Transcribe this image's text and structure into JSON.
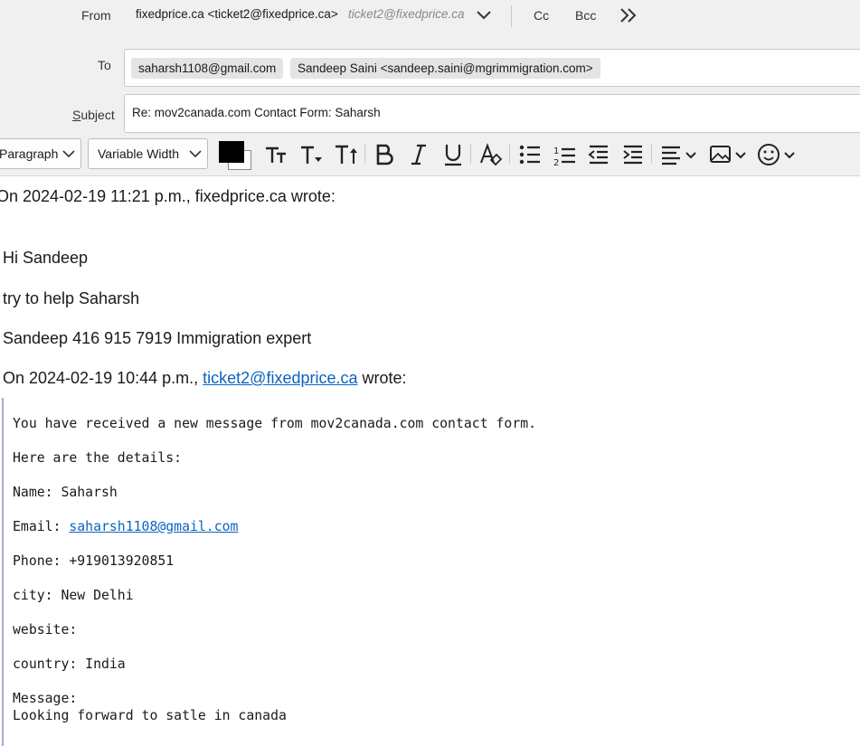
{
  "header": {
    "from_label": "From",
    "from_value": "fixedprice.ca <ticket2@fixedprice.ca>",
    "from_hint": "ticket2@fixedprice.ca",
    "cc_label": "Cc",
    "bcc_label": "Bcc",
    "to_label": "To",
    "recipients": [
      "saharsh1108@gmail.com",
      "Sandeep Saini <sandeep.saini@mgrimmigration.com>"
    ],
    "subject_label_first": "S",
    "subject_label_rest": "ubject",
    "subject_value": "Re: mov2canada.com Contact Form: Saharsh"
  },
  "toolbar": {
    "paragraph_format": "Paragraph",
    "font_face": "Variable Width",
    "text_color": "#000000",
    "background_color": "#ffffff"
  },
  "body": {
    "attribution_1": "On 2024-02-19 11:21 p.m., fixedprice.ca wrote:",
    "greeting": "Hi Sandeep",
    "line_2": "try to help Saharsh",
    "line_3": "Sandeep 416 915 7919 Immigration expert",
    "attribution_2_prefix": "On 2024-02-19 10:44 p.m., ",
    "attribution_2_link": "ticket2@fixedprice.ca",
    "attribution_2_suffix": " wrote:",
    "quoted": {
      "intro": "You have received a new message from mov2canada.com contact form.",
      "details": "Here are the details:",
      "name": "Name: Saharsh",
      "email_label": "Email: ",
      "email_link": "saharsh1108@gmail.com",
      "phone": "Phone: +919013920851",
      "city": "city: New Delhi",
      "website": "website:",
      "country": "country: India",
      "message_label": "Message:",
      "message_text": "Looking forward to satle in canada"
    }
  },
  "colors": {
    "link": "#0b63c1",
    "quote_bar": "#b9a5d6",
    "chrome_bg": "#f0f0f0"
  }
}
